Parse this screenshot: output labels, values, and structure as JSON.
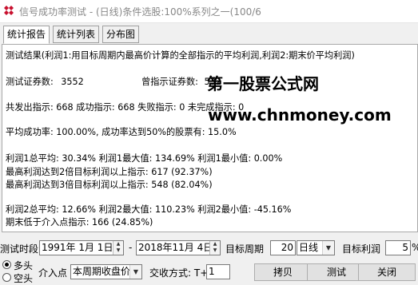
{
  "window": {
    "title": "信号成功率测试 - (日线)条件选股:100%系列之一(100/6"
  },
  "tabs": [
    {
      "label": "统计报告",
      "active": true
    },
    {
      "label": "统计列表",
      "active": false
    },
    {
      "label": "分布图",
      "active": false
    }
  ],
  "report": {
    "line1": "测试结果(利润1:用目标周期内最高价计算的全部指示的平均利润,利润2:期末价平均利润)",
    "securities_label": "测试证券数:",
    "securities_value": "3552",
    "signaled_label": "曾指示证券数:",
    "signaled_value": "532",
    "signals_line": "共发出指示: 668   成功指示: 668   失败指示: 0   未完成指示: 0",
    "success_line": "平均成功率: 100.00%,  成功率达到50%的股票有: 15.0%",
    "profit1_line": "利润1总平均: 30.34%   利润1最大值: 134.69%   利润1最小值: 0.00%",
    "max2x_line": "最高利润达到2倍目标利润以上指示: 617 (92.37%)",
    "max3x_line": "最高利润达到3倍目标利润以上指示: 548 (82.04%)",
    "profit2_line": "利润2总平均: 12.66%   利润2最大值: 110.23%   利润2最小值: -45.16%",
    "below_entry_line": "期末低于介入点指示: 166 (24.85%)"
  },
  "watermark": {
    "title": "第一股票公式网",
    "url": "www.chnmoney.com"
  },
  "controls": {
    "period_label": "测试时段",
    "start_date": "1991年 1月 1日",
    "dash": "-",
    "end_date": "2018年11月 4日",
    "target_period_label": "目标周期",
    "target_period_value": "20",
    "period_unit": "日线",
    "target_profit_label": "目标利润",
    "target_profit_value": "5",
    "target_profit_unit": "%",
    "radio_long": "多头",
    "radio_short": "空头",
    "entry_label": "介入点",
    "entry_value": "本周期收盘价",
    "trade_label": "交收方式: T+",
    "trade_value": "1",
    "copy_button": "拷贝",
    "test_button": "测试",
    "close_button": "关闭"
  }
}
